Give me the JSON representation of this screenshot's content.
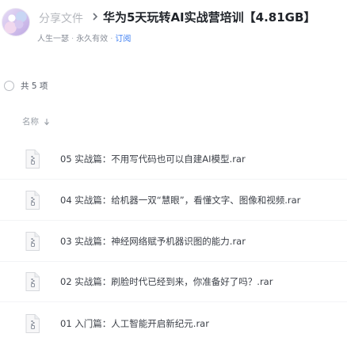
{
  "header": {
    "breadcrumb_root": "分享文件",
    "title": "华为5天玩转AI实战营培训【4.81GB】",
    "owner": "人生一瑟",
    "validity": "永久有效",
    "subscribe": "订阅"
  },
  "toolbar": {
    "count_label": "共 5 项"
  },
  "columns": {
    "name_label": "名称"
  },
  "files": [
    {
      "name": "05 实战篇：不用写代码也可以自建AI模型.rar",
      "icon": "archive-file-icon"
    },
    {
      "name": "04 实战篇：给机器一双“慧眼”，看懂文字、图像和视频.rar",
      "icon": "archive-file-icon"
    },
    {
      "name": "03 实战篇：神经网络赋予机器识图的能力.rar",
      "icon": "archive-file-icon"
    },
    {
      "name": "02 实战篇：刷脸时代已经到来，你准备好了吗？.rar",
      "icon": "archive-file-icon"
    },
    {
      "name": "01 入门篇：人工智能开启新纪元.rar",
      "icon": "archive-file-icon"
    }
  ],
  "colors": {
    "accent": "#3a7cf2",
    "muted_text": "#8a8f99",
    "title_text": "#1f2329"
  }
}
